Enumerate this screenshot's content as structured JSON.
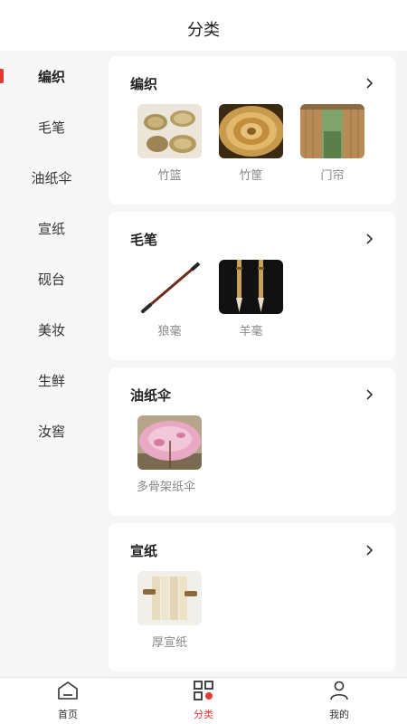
{
  "header": {
    "title": "分类"
  },
  "sidebar": {
    "items": [
      {
        "label": "编织"
      },
      {
        "label": "毛笔"
      },
      {
        "label": "油纸伞"
      },
      {
        "label": "宣纸"
      },
      {
        "label": "砚台"
      },
      {
        "label": "美妆"
      },
      {
        "label": "生鲜"
      },
      {
        "label": "汝窖"
      }
    ]
  },
  "cards": [
    {
      "title": "编织",
      "items": [
        {
          "label": "竹篮"
        },
        {
          "label": "竹筐"
        },
        {
          "label": "门帘"
        }
      ]
    },
    {
      "title": "毛笔",
      "items": [
        {
          "label": "狼毫"
        },
        {
          "label": "羊毫"
        }
      ]
    },
    {
      "title": "油纸伞",
      "items": [
        {
          "label": "多骨架纸伞"
        }
      ]
    },
    {
      "title": "宣纸",
      "items": [
        {
          "label": "厚宣纸"
        }
      ]
    }
  ],
  "tabbar": {
    "home": "首页",
    "category": "分类",
    "mine": "我的"
  },
  "colors": {
    "accent": "#e53935"
  }
}
